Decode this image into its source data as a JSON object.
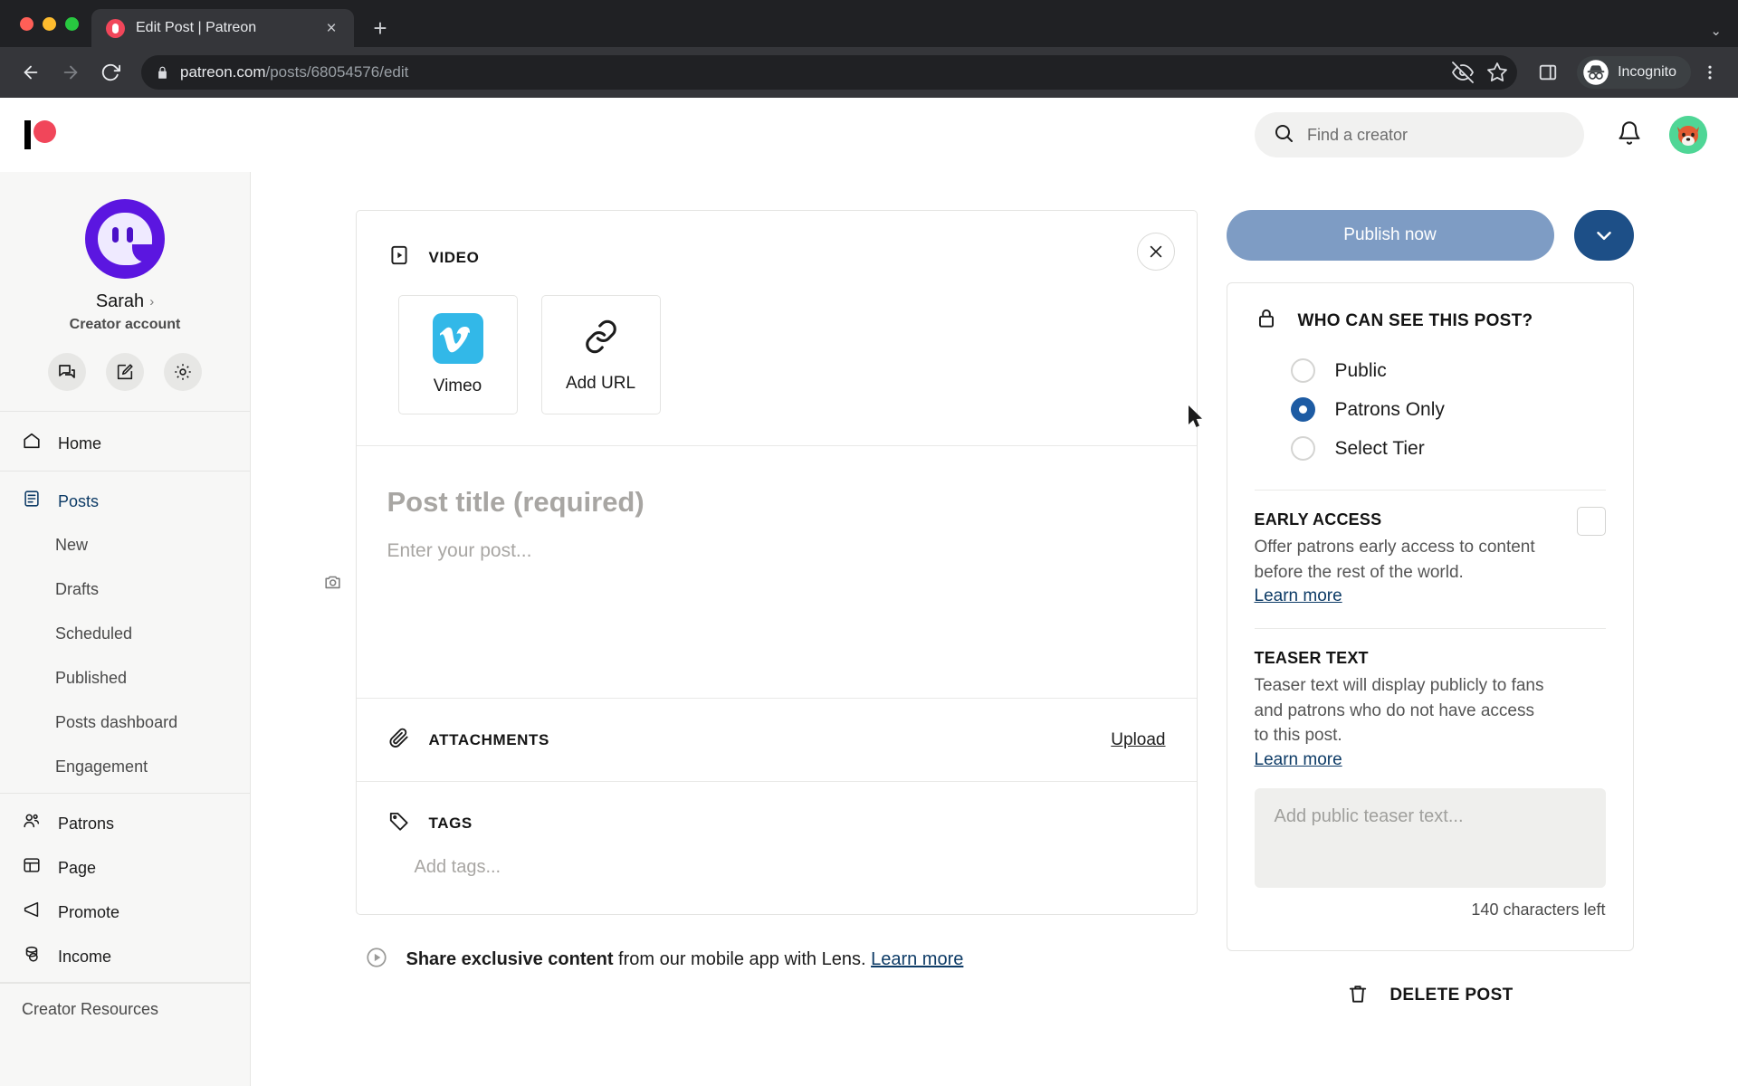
{
  "browser": {
    "tab": {
      "title": "Edit Post | Patreon",
      "favicon": "patreon-favicon",
      "close": "×"
    },
    "new_tab": "+",
    "tabstrip_chevron": "⌄",
    "url_domain": "patreon.com",
    "url_path": "/posts/68054576/edit",
    "profile_label": "Incognito"
  },
  "header": {
    "search_placeholder": "Find a creator"
  },
  "sidebar": {
    "profile_name": "Sarah",
    "profile_chevron": "›",
    "profile_role": "Creator account",
    "actions": [
      "chat-icon",
      "edit-icon",
      "gear-icon"
    ],
    "home": "Home",
    "posts": "Posts",
    "sub_items": [
      "New",
      "Drafts",
      "Scheduled",
      "Published",
      "Posts dashboard",
      "Engagement"
    ],
    "items": [
      "Patrons",
      "Page",
      "Promote",
      "Income"
    ],
    "creator_resources": "Creator Resources"
  },
  "editor": {
    "video_section_title": "VIDEO",
    "tiles": [
      {
        "label": "Vimeo",
        "icon": "vimeo-logo"
      },
      {
        "label": "Add URL",
        "icon": "link-icon"
      }
    ],
    "title_placeholder": "Post title (required)",
    "body_placeholder": "Enter your post...",
    "attachments_title": "ATTACHMENTS",
    "upload_label": "Upload",
    "tags_title": "TAGS",
    "tags_placeholder": "Add tags...",
    "lens_bold": "Share exclusive content",
    "lens_rest": " from our mobile app with Lens. ",
    "lens_link": "Learn more"
  },
  "rail": {
    "publish_label": "Publish now",
    "visibility_title": "WHO CAN SEE THIS POST?",
    "visibility_options": [
      "Public",
      "Patrons Only",
      "Select Tier"
    ],
    "visibility_selected": "Patrons Only",
    "early_access": {
      "title": "EARLY ACCESS",
      "desc": "Offer patrons early access to content before the rest of the world.",
      "link": "Learn more"
    },
    "teaser": {
      "title": "TEASER TEXT",
      "desc": "Teaser text will display publicly to fans and patrons who do not have access to this post.",
      "link": "Learn more",
      "placeholder": "Add public teaser text...",
      "counter": "140 characters left"
    },
    "delete_label": "DELETE POST"
  },
  "colors": {
    "brand_red": "#f1465a",
    "publish_blue": "#7e9cc4",
    "chevron_blue": "#1d4f87",
    "radio_blue": "#1d5ba3",
    "vimeo_cyan": "#32b8e8",
    "link_navy": "#0d3b66"
  }
}
